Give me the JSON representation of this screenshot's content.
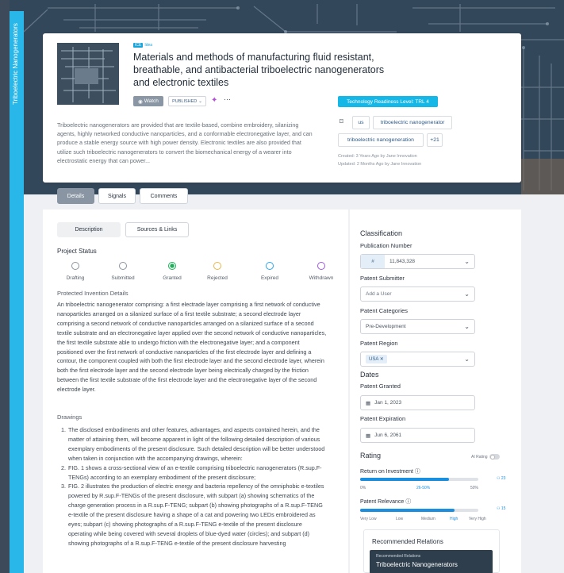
{
  "vertical_tab": "Triboelectric Nanogenerators",
  "idea": {
    "badge": "ICE",
    "type": "Idea",
    "title": "Materials and methods of manufacturing fluid resistant, breathable, and antibacterial triboelectric nanogenerators and electronic textiles",
    "watch_label": "Watch",
    "status_label": "PUBLISHED",
    "more_label": "···",
    "description": "Triboelectric nanogenerators are provided that are textile-based, combine embroidery, silanizing agents, highly networked conductive nanoparticles, and a conformable electronegative layer, and can produce a stable energy source with high power density. Electronic textiles are also provided that utilize such triboelectric nanogenerators to convert the biomechanical energy of a wearer into electrostatic energy that can power...",
    "trl": "Technology Readiness Level: TRL 4",
    "tags": [
      "us",
      "triboelectric nanogenerator",
      "triboelectric nanogeneration",
      "+21"
    ],
    "created": "Created: 3 Years Ago by Jane Innovation",
    "updated": "Updated: 2 Months Ago by Jane Innovation"
  },
  "tabs": [
    "Details",
    "Signals",
    "Comments"
  ],
  "subtabs": [
    "Description",
    "Sources & Links"
  ],
  "project_status": {
    "heading": "Project Status",
    "items": [
      {
        "label": "Drafting",
        "color": "#8a949e"
      },
      {
        "label": "Submitted",
        "color": "#8a949e"
      },
      {
        "label": "Granted",
        "color": "#1fae5a"
      },
      {
        "label": "Rejected",
        "color": "#e8b64a"
      },
      {
        "label": "Expired",
        "color": "#2aa6e8"
      },
      {
        "label": "Withdrawn",
        "color": "#9a5bd6"
      }
    ],
    "selected": "Granted"
  },
  "protected": {
    "heading": "Protected Invention Details",
    "text": "An triboelectric nanogenerator comprising: a first electrade layer comprising a first network of conductive nanoparticles arranged on a silanized surface of a first textile substrate; a second electrode layer comprising a second network of conductive nanoparticles arranged on a silanized surface of a second textile substrate and an electronegative layer applied over the second network of conductive nanoparticles, the first textile substrate able to undergo friction with the electronegative layer; and a component positioned over the first network of conductive nanoparticles of the first electrode layer and defining a contour, the component coupled with both the first electrode layer and the second electrode layer, wherein both the first electrode layer and the second electrode layer being electrically charged by the friction between the first textile substrate of the first electrode layer and the electronegative layer of the second electrode layer."
  },
  "drawings": {
    "heading": "Drawings",
    "items": [
      "The disclosed embodiments and other features, advantages, and aspects contained herein, and the matter of attaining them, will become apparent in light of the following detailed description of various exemplary embodiments of the present disclosure. Such detailed description will be better understood when taken in conjunction with the accompanying drawings, wherein:",
      "FIG. 1 shows a cross-sectional view of an e-textile comprising triboelectric nanogenerators (R.sup.F-TENGs) according to an exemplary embodiment of the present disclosure;",
      "FIG. 2 illustrates the production of electric energy and bacteria repellency of the omniphobic e-textiles powered by R.sup.F-TENGs of the present disclosure, with subpart (a) showing schematics of the charge generation process in a R.sup.F-TENG; subpart (b) showing photographs of a R.sup.F-TENG e-textile of the present disclosure having a shape of a cat and powering two LEDs embroidered as eyes; subpart (c) showing photographs of a R.sup.F-TENG e-textile of the present disclosure operating while being covered with several droplets of blue-dyed water (circles); and subpart (d) showing photographs of a R.sup.F-TENG e-textile of the present disclosure harvesting"
    ]
  },
  "classification": {
    "heading": "Classification",
    "pub_label": "Publication Number",
    "pub_prefix": "#",
    "pub_value": "11,843,328",
    "submitter_label": "Patent Submitter",
    "submitter_placeholder": "Add a User",
    "categories_label": "Patent Categories",
    "categories_value": "Pre-Development",
    "region_label": "Patent Region",
    "region_value": "USA"
  },
  "dates": {
    "heading": "Dates",
    "granted_label": "Patent Granted",
    "granted_value": "Jan 1, 2023",
    "expiration_label": "Patent Expiration",
    "expiration_value": "Jun 6, 2061"
  },
  "rating": {
    "heading": "Rating",
    "ai_label": "AI Rating",
    "roi_label": "Return on Investment",
    "roi_fraction": 0.75,
    "roi_ticks": [
      "0%",
      "26-50%",
      "50%"
    ],
    "roi_count": "23",
    "relevance_label": "Patent Relevance",
    "relevance_fraction": 0.8,
    "relevance_ticks": [
      "Very Low",
      "Low",
      "Medium",
      "High",
      "Very High"
    ],
    "relevance_count": "15"
  },
  "recommended": {
    "heading": "Recommended Relations",
    "card_sub": "Recommended Relations",
    "card_title": "Triboelectric Nanogenerators"
  }
}
